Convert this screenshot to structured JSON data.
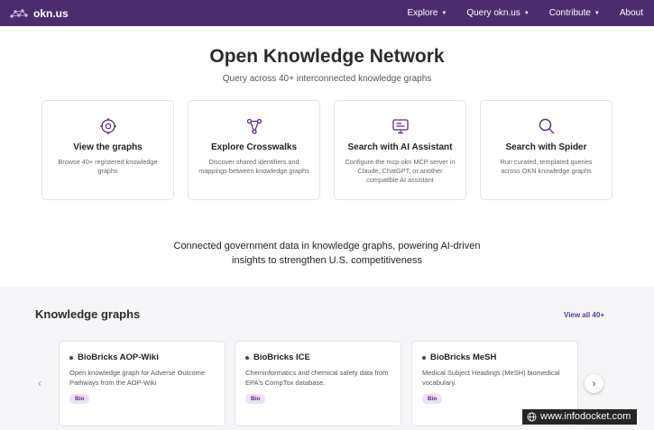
{
  "nav": {
    "brand": "okn.us",
    "items": [
      {
        "label": "Explore",
        "has_caret": true
      },
      {
        "label": "Query okn.us",
        "has_caret": true
      },
      {
        "label": "Contribute",
        "has_caret": true
      },
      {
        "label": "About",
        "has_caret": false
      }
    ]
  },
  "hero": {
    "title": "Open Knowledge Network",
    "subtitle": "Query across 40+ interconnected knowledge graphs"
  },
  "cards": [
    {
      "icon": "target-icon",
      "title": "View the graphs",
      "desc": "Browse 40+ registered knowledge graphs"
    },
    {
      "icon": "crosswalk-icon",
      "title": "Explore Crosswalks",
      "desc": "Discover shared identifiers and mappings between knowledge graphs"
    },
    {
      "icon": "ai-assistant-icon",
      "title": "Search with AI Assistant",
      "desc": "Configure the mcp-okn MCP server in Claude, ChatGPT, or another compatible AI assistant"
    },
    {
      "icon": "search-icon",
      "title": "Search with Spider",
      "desc": "Run curated, templated queries across OKN knowledge graphs"
    }
  ],
  "tagline": {
    "line1": "Connected government data in knowledge graphs, powering AI-driven",
    "line2": "insights to strengthen U.S. competitiveness"
  },
  "kg": {
    "title": "Knowledge graphs",
    "view_all": "View all 40+",
    "items": [
      {
        "name": "BioBricks AOP-Wiki",
        "desc": "Open knowledge graph for Adverse Outcome Pathways from the AOP-Wiki",
        "badge": "Bio"
      },
      {
        "name": "BioBricks ICE",
        "desc": "Cheminformatics and chemical safety data from EPA's CompTox database.",
        "badge": "Bio"
      },
      {
        "name": "BioBricks MeSH",
        "desc": "Medical Subject Headings (MeSH) biomedical vocabulary.",
        "badge": "Bio"
      }
    ]
  },
  "watermark": "www.infodocket.com",
  "colors": {
    "nav_bg": "#4b2d6f",
    "accent": "#5a2d82",
    "badge_bg": "#ece2f4",
    "section_bg": "#f6f5f7"
  }
}
